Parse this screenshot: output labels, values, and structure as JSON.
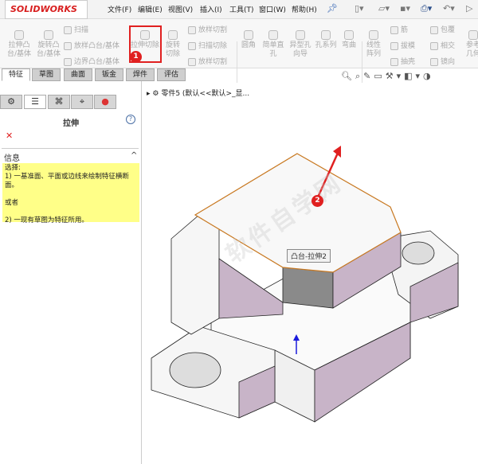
{
  "app": {
    "logo": "SOLIDWORKS"
  },
  "menu": [
    "文件(F)",
    "编辑(E)",
    "视图(V)",
    "插入(I)",
    "工具(T)",
    "窗口(W)",
    "帮助(H)"
  ],
  "toolbar": {
    "big": [
      "拉伸凸台/基体",
      "旋转凸台/基体",
      "拉伸切除",
      "旋转切除",
      "圆角",
      "简单直孔",
      "异型孔向导",
      "孔系列",
      "弯曲",
      "线性阵列",
      "参考几何"
    ],
    "small": [
      "扫描",
      "放样凸台/基体",
      "边界凸台/基体",
      "放样切割",
      "扫描切除",
      "放样切割",
      "筋",
      "拔模",
      "抽壳",
      "包覆",
      "相交",
      "镜向"
    ]
  },
  "tabs": [
    "特征",
    "草图",
    "曲面",
    "钣金",
    "焊件",
    "评估"
  ],
  "panel": {
    "title": "拉伸",
    "info_header": "信息",
    "info_lines": [
      "选择:",
      "1) 一基准面、平面或边线来绘制特征横断面。",
      "",
      "或者",
      "",
      "2) 一现有草图为特征所用。"
    ]
  },
  "tree": {
    "label": "零件5  (默认<<默认>_显..."
  },
  "tooltip": "凸台-拉伸2",
  "badges": [
    "1",
    "2"
  ],
  "watermark": "软件自学网",
  "colors": {
    "highlight": "#e02020",
    "note": "#ffff88",
    "edge": "#c87820",
    "face_side": "#c8b4c8"
  }
}
